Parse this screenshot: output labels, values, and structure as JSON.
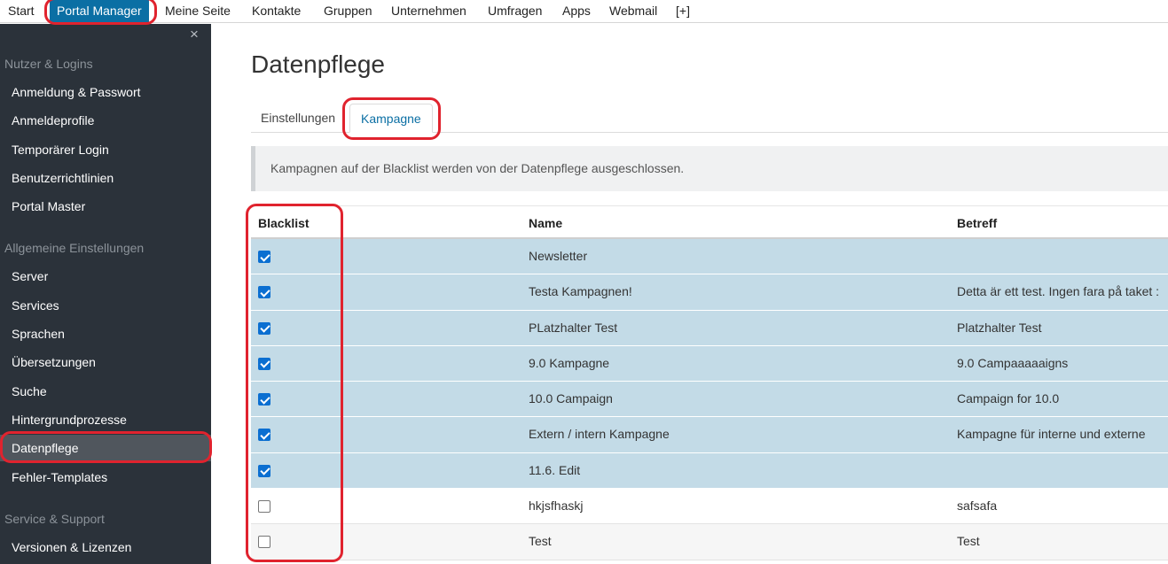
{
  "topnav": {
    "items": [
      {
        "label": "Start"
      },
      {
        "label": "Portal Manager",
        "active": true
      },
      {
        "label": "Meine Seite"
      },
      {
        "label": "Kontakte"
      },
      {
        "label": "Gruppen"
      },
      {
        "label": "Unternehmen"
      },
      {
        "label": "Umfragen"
      },
      {
        "label": "Apps"
      },
      {
        "label": "Webmail"
      },
      {
        "label": "[+]"
      }
    ]
  },
  "sidebar": {
    "close_glyph": "×",
    "sections": [
      {
        "title": "Nutzer & Logins",
        "items": [
          "Anmeldung & Passwort",
          "Anmeldeprofile",
          "Temporärer Login",
          "Benutzerrichtlinien",
          "Portal Master"
        ]
      },
      {
        "title": "Allgemeine Einstellungen",
        "items": [
          "Server",
          "Services",
          "Sprachen",
          "Übersetzungen",
          "Suche",
          "Hintergrundprozesse",
          "Datenpflege",
          "Fehler-Templates"
        ]
      },
      {
        "title": "Service & Support",
        "items": [
          "Versionen & Lizenzen"
        ]
      }
    ],
    "active_item": "Datenpflege"
  },
  "main": {
    "title": "Datenpflege",
    "tabs": [
      {
        "label": "Einstellungen"
      },
      {
        "label": "Kampagne",
        "active": true
      }
    ],
    "info": "Kampagnen auf der Blacklist werden von der Datenpflege ausgeschlossen.",
    "table": {
      "headers": {
        "blacklist": "Blacklist",
        "name": "Name",
        "betreff": "Betreff"
      },
      "rows": [
        {
          "checked": true,
          "name": "Newsletter",
          "betreff": ""
        },
        {
          "checked": true,
          "name": "Testa Kampagnen!",
          "betreff": "Detta är ett test. Ingen fara på taket :"
        },
        {
          "checked": true,
          "name": "PLatzhalter Test",
          "betreff": "Platzhalter Test"
        },
        {
          "checked": true,
          "name": "9.0 Kampagne",
          "betreff": "9.0 Campaaaaaigns"
        },
        {
          "checked": true,
          "name": "10.0 Campaign",
          "betreff": "Campaign for 10.0"
        },
        {
          "checked": true,
          "name": "Extern / intern Kampagne",
          "betreff": "Kampagne für interne und externe"
        },
        {
          "checked": true,
          "name": "11.6. Edit",
          "betreff": ""
        },
        {
          "checked": false,
          "name": "hkjsfhaskj",
          "betreff": "safsafa"
        },
        {
          "checked": false,
          "name": "Test",
          "betreff": "Test"
        }
      ]
    }
  },
  "colors": {
    "accent": "#0b6fa4",
    "selected_row": "#c3dbe7",
    "sidebar_bg": "#2b323a",
    "annotation": "#e0232e"
  }
}
